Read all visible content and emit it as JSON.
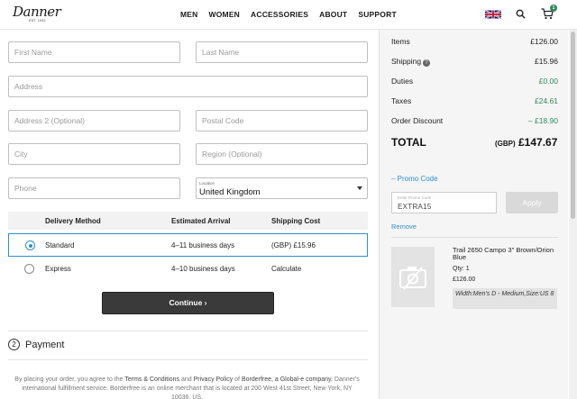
{
  "header": {
    "logo_text": "Danner",
    "logo_sub": "EST. 1932",
    "nav": [
      "MEN",
      "WOMEN",
      "ACCESSORIES",
      "ABOUT",
      "SUPPORT"
    ],
    "cart_count": "1"
  },
  "form": {
    "first_name": "First Name",
    "last_name": "Last Name",
    "address": "Address",
    "address2": "Address 2 (Optional)",
    "postal": "Postal Code",
    "city": "City",
    "region": "Region (Optional)",
    "phone": "Phone",
    "location_label": "Location",
    "location_value": "United Kingdom"
  },
  "delivery": {
    "headers": [
      "Delivery Method",
      "Estimated Arrival",
      "Shipping Cost"
    ],
    "rows": [
      {
        "method": "Standard",
        "arrival": "4–11 business days",
        "cost": "(GBP) £15.96"
      },
      {
        "method": "Express",
        "arrival": "4–10 business days",
        "cost": "Calculate"
      }
    ]
  },
  "continue_label": "Continue ›",
  "payment": {
    "num": "2",
    "title": "Payment"
  },
  "legal": {
    "p1": "By placing your order, you agree to the ",
    "terms": "Terms & Conditions",
    "and": " and ",
    "privacy": "Privacy Policy",
    "of": " of ",
    "borderfree": "Borderfree, a Global-e company",
    "p2": ", Danner's international fulfillment service. Borderfree is an online merchant that is located at 200 West 41st Street, New York, NY 10036, US."
  },
  "summary": {
    "items_label": "Items",
    "items_value": "£126.00",
    "shipping_label": "Shipping",
    "shipping_value": "£15.96",
    "duties_label": "Duties",
    "duties_value": "£0.00",
    "taxes_label": "Taxes",
    "taxes_value": "£24.61",
    "discount_label": "Order Discount",
    "discount_value": "– £18.90",
    "total_label": "TOTAL",
    "total_currency": "(GBP)",
    "total_value": "£147.67",
    "promo_link": "– Promo Code",
    "promo_placeholder": "Enter Promo Code",
    "promo_value": "EXTRA15",
    "apply_label": "Apply",
    "remove_label": "Remove"
  },
  "product": {
    "name": "Trail 2650 Campo 3\" Brown/Orion Blue",
    "qty": "Qty: 1",
    "price": "£126.00",
    "variant": "Width:Men's D - Medium,Size:US 8"
  },
  "colors": {
    "accent": "#2e8fd1",
    "green": "#2e8b57",
    "button": "#3a3a3a"
  }
}
